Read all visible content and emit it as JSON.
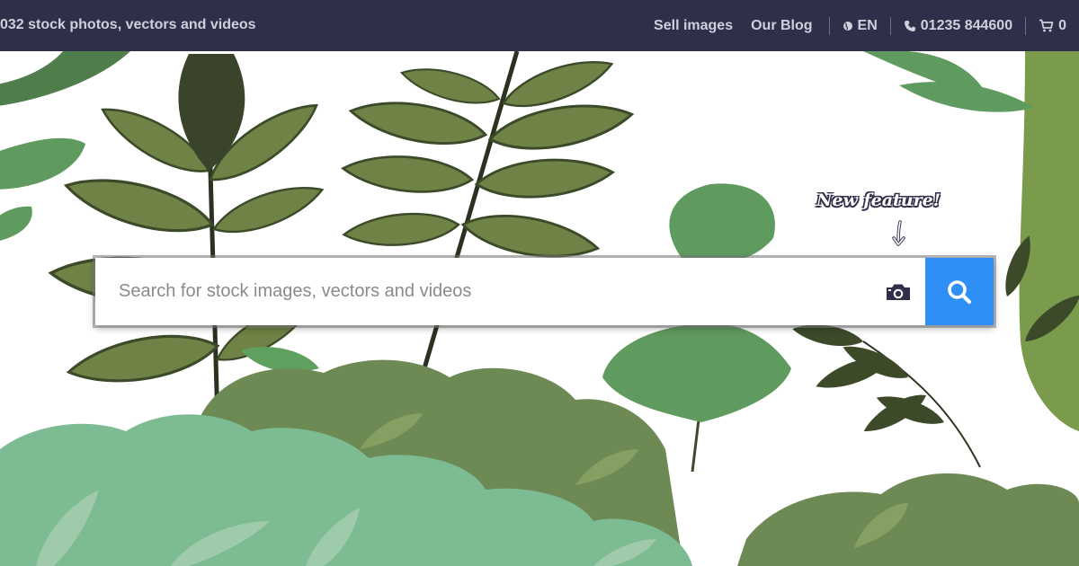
{
  "topbar": {
    "count_text": "032  stock photos, vectors and videos",
    "links": {
      "sell": "Sell images",
      "blog": "Our Blog"
    },
    "language": "EN",
    "phone": "01235 844600",
    "cart_count": "0"
  },
  "search": {
    "placeholder": "Search for stock images, vectors and videos",
    "value": ""
  },
  "callout": {
    "text": "New feature!"
  },
  "colors": {
    "topbar_bg": "#2f2f49",
    "search_button": "#2e8ff5",
    "leaf_dark": "#3d4a2a",
    "leaf_olive": "#6f8346",
    "leaf_green": "#5f9a5f",
    "bush_mint": "#7dbb93"
  },
  "icons": {
    "camera": "camera-icon",
    "search": "magnifier-icon",
    "globe": "globe-icon",
    "phone": "phone-icon",
    "cart": "cart-icon"
  }
}
